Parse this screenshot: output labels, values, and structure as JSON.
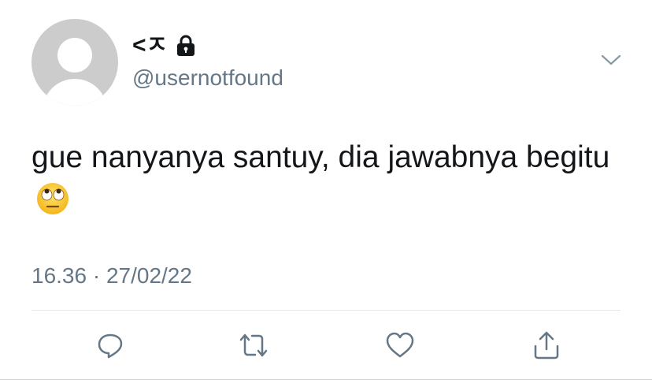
{
  "tweet": {
    "display_name": "<ㅈ",
    "handle": "@usernotfound",
    "text": "gue nanyanya santuy, dia jawabnya begitu",
    "timestamp": "16.36 · 27/02/22",
    "emoji": "face-with-rolling-eyes"
  },
  "icons": {
    "lock": "lock-icon",
    "menu": "chevron-down-icon",
    "reply": "reply-icon",
    "retweet": "retweet-icon",
    "like": "heart-icon",
    "share": "share-icon"
  },
  "colors": {
    "text": "#14171a",
    "secondary": "#657786",
    "avatar_bg": "#cccccc",
    "divider": "#e1e8ed",
    "action_icon": "#657786"
  }
}
